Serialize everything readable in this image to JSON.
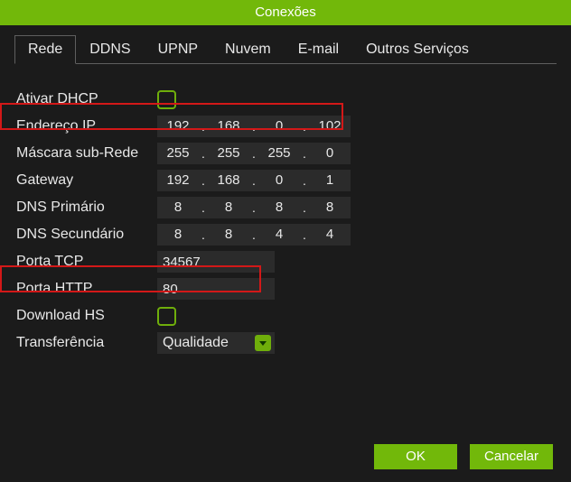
{
  "title": "Conexões",
  "tabs": [
    "Rede",
    "DDNS",
    "UPNP",
    "Nuvem",
    "E-mail",
    "Outros Serviços"
  ],
  "activeTab": 0,
  "labels": {
    "dhcp": "Ativar DHCP",
    "ip": "Endereço IP",
    "mask": "Máscara sub-Rede",
    "gw": "Gateway",
    "dns1": "DNS Primário",
    "dns2": "DNS Secundário",
    "tcp": "Porta TCP",
    "http": "Porta HTTP",
    "dlhs": "Download HS",
    "transfer": "Transferência"
  },
  "values": {
    "ip": [
      "192",
      "168",
      "0",
      "102"
    ],
    "mask": [
      "255",
      "255",
      "255",
      "0"
    ],
    "gw": [
      "192",
      "168",
      "0",
      "1"
    ],
    "dns1": [
      "8",
      "8",
      "8",
      "8"
    ],
    "dns2": [
      "8",
      "8",
      "4",
      "4"
    ],
    "tcp": "34567",
    "http": "80",
    "transfer": "Qualidade"
  },
  "buttons": {
    "ok": "OK",
    "cancel": "Cancelar"
  }
}
